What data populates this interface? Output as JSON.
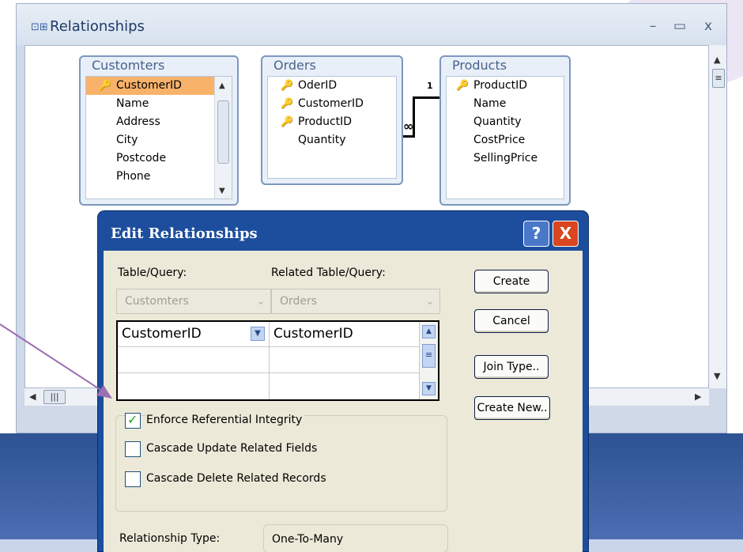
{
  "relationships_window": {
    "title": "Relationships",
    "minimize_glyph": "–",
    "maximize_glyph": "▭",
    "close_glyph": "x"
  },
  "tables": [
    {
      "name": "Customters",
      "fields": [
        "CustomerID",
        "Name",
        "Address",
        "City",
        "Postcode",
        "Phone"
      ],
      "key_fields": [
        "CustomerID"
      ],
      "selected_field": "CustomerID"
    },
    {
      "name": "Orders",
      "fields": [
        "OderID",
        "CustomerID",
        "ProductID",
        "Quantity"
      ],
      "key_fields": [
        "OderID",
        "CustomerID",
        "ProductID"
      ]
    },
    {
      "name": "Products",
      "fields": [
        "ProductID",
        "Name",
        "Quantity",
        "CostPrice",
        "SellingPrice"
      ],
      "key_fields": [
        "ProductID"
      ]
    }
  ],
  "relationship_markers": {
    "one": "1",
    "many": "∞"
  },
  "dialog": {
    "title": "Edit Relationships",
    "help_glyph": "?",
    "close_glyph": "X",
    "table_query_label": "Table/Query:",
    "related_table_query_label": "Related Table/Query:",
    "table_query_value": "Customters",
    "related_table_query_value": "Orders",
    "grid_rows": [
      {
        "left": "CustomerID",
        "right": "CustomerID"
      },
      {
        "left": "",
        "right": ""
      },
      {
        "left": "",
        "right": ""
      }
    ],
    "buttons": {
      "create": "Create",
      "cancel": "Cancel",
      "join_type": "Join Type..",
      "create_new": "Create New.."
    },
    "checkboxes": [
      {
        "label": "Enforce Referential Integrity",
        "checked": true
      },
      {
        "label": "Cascade Update Related Fields",
        "checked": false
      },
      {
        "label": "Cascade Delete Related Records",
        "checked": false
      }
    ],
    "relationship_type_label": "Relationship Type:",
    "relationship_type_value": "One-To-Many"
  },
  "colors": {
    "dialog_title_bar": "#1d4e9d",
    "selected_field": "#f9b26a",
    "close_button": "#d9461f",
    "annotation_arrow": "#9b6fb4"
  }
}
